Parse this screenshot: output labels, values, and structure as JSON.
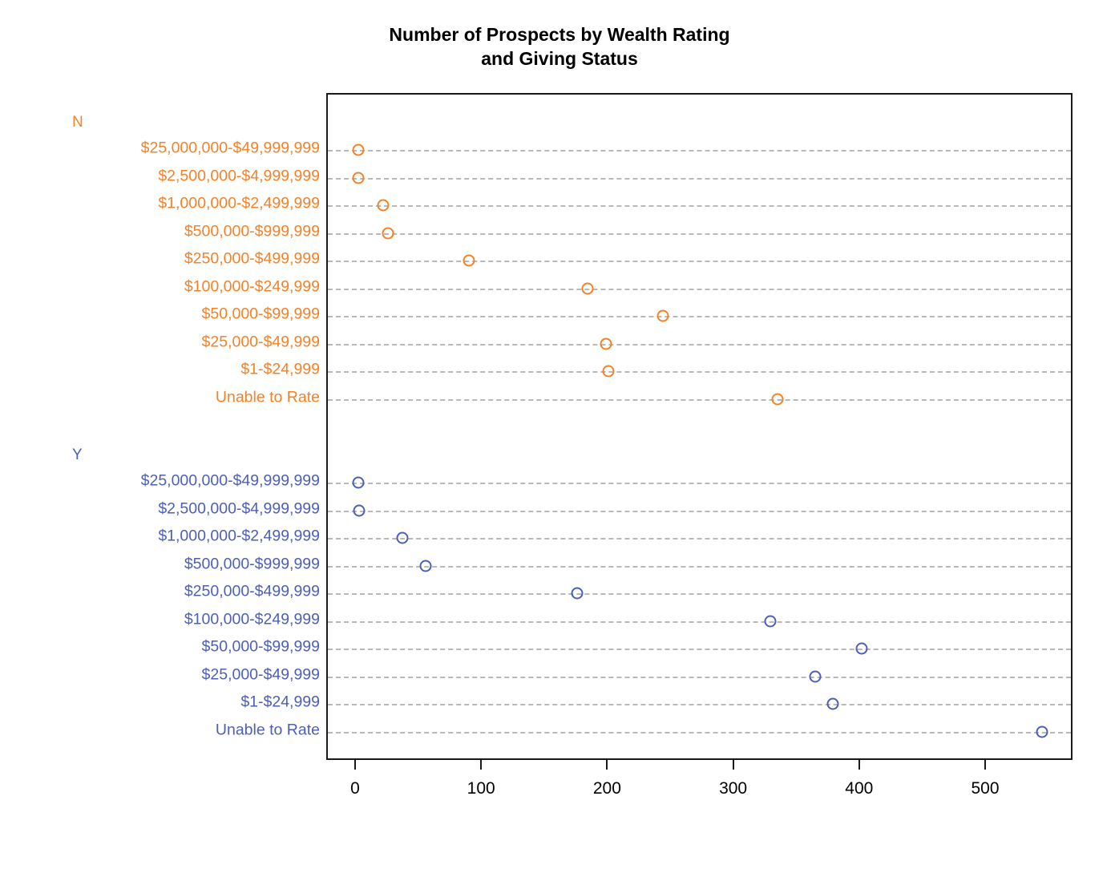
{
  "chart_data": {
    "type": "scatter",
    "title": "Number of Prospects by Wealth Rating\nand Giving Status",
    "xlabel": "",
    "ylabel": "",
    "xlim": [
      -22,
      570
    ],
    "xticks": [
      0,
      100,
      200,
      300,
      400,
      500
    ],
    "xtick_labels": [
      "0",
      "100",
      "200",
      "300",
      "400",
      "500"
    ],
    "grid": true,
    "grid_style": "dotted-horizontal",
    "legend": "none",
    "orientation": "horizontal-dot-plot",
    "categories": [
      "$25,000,000-$49,999,999",
      "$2,500,000-$4,999,999",
      "$1,000,000-$2,499,999",
      "$500,000-$999,999",
      "$250,000-$499,999",
      "$100,000-$249,999",
      "$50,000-$99,999",
      "$25,000-$49,999",
      "$1-$24,999",
      "Unable to Rate"
    ],
    "groups": [
      {
        "name": "N",
        "label": "N",
        "color": "#F58227",
        "values": [
          1,
          1,
          21,
          25,
          89,
          183,
          243,
          198,
          200,
          334
        ]
      },
      {
        "name": "Y",
        "label": "Y",
        "color": "#4C5FB8",
        "values": [
          1,
          2,
          36,
          55,
          175,
          328,
          401,
          364,
          378,
          544
        ]
      }
    ],
    "colors": {
      "series_n": "#F58227",
      "series_y": "#4C5FB8",
      "frame": "#1a1a1a",
      "grid": "#b9b9b9",
      "title": "#000000",
      "background": "#ffffff"
    }
  }
}
